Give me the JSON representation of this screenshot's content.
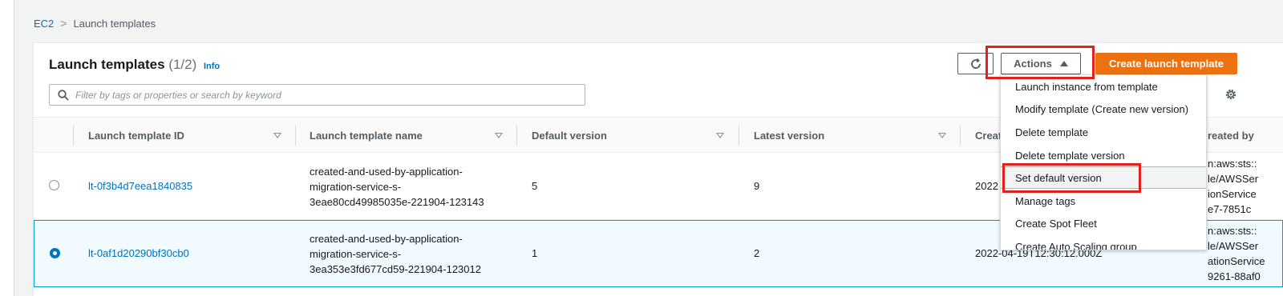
{
  "breadcrumb": {
    "root": "EC2",
    "current": "Launch templates"
  },
  "header": {
    "title": "Launch templates",
    "count": "(1/2)",
    "info": "Info"
  },
  "search": {
    "placeholder": "Filter by tags or properties or search by keyword"
  },
  "toolbar": {
    "actions_label": "Actions",
    "create_label": "Create launch template"
  },
  "table": {
    "columns": [
      "Launch template ID",
      "Launch template name",
      "Default version",
      "Latest version",
      "Creat",
      "reated by"
    ],
    "rows": [
      {
        "selected": false,
        "id": "lt-0f3b4d7eea1840835",
        "name": [
          "created-and-used-by-application-",
          "migration-service-s-",
          "3eae80cd49985035e-221904-123143"
        ],
        "default_version": "5",
        "latest_version": "9",
        "created": "2022",
        "created_by": [
          "n:aws:sts::",
          "le/AWSSer",
          "ionService",
          "e7-7851c"
        ]
      },
      {
        "selected": true,
        "id": "lt-0af1d20290bf30cb0",
        "name": [
          "created-and-used-by-application-",
          "migration-service-s-",
          "3ea353e3fd677cd59-221904-123012"
        ],
        "default_version": "1",
        "latest_version": "2",
        "created": "2022-04-19T12:30:12.000Z",
        "created_by": [
          "n:aws:sts::",
          "le/AWSSer",
          "ationService",
          "9261-88af0"
        ]
      }
    ]
  },
  "actions_menu": {
    "items": [
      "Launch instance from template",
      "Modify template (Create new version)",
      "Delete template",
      "Delete template version",
      "Set default version",
      "Manage tags",
      "Create Spot Fleet",
      "Create Auto Scaling group"
    ],
    "highlighted_item": "Set default version"
  },
  "colors": {
    "accent": "#ec7211",
    "link": "#0073bb",
    "highlight_box": "#e0221c"
  },
  "icons": {
    "refresh": "refresh-icon",
    "search": "search-icon",
    "settings": "gear-icon",
    "caret": "caret-up-icon"
  }
}
